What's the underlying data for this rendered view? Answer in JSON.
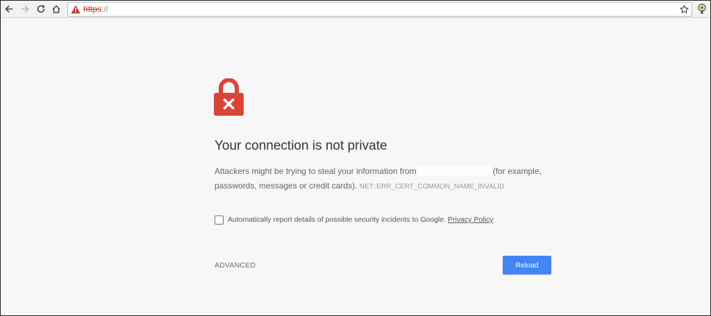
{
  "browser": {
    "url_scheme": "https",
    "url_rest": "://",
    "icons": {
      "back": "back-arrow-icon",
      "forward": "forward-arrow-icon",
      "reload": "reload-icon",
      "home": "home-icon",
      "warning": "warning-triangle-icon",
      "bookmark": "star-icon",
      "extension": "extension-icon"
    }
  },
  "interstitial": {
    "heading": "Your connection is not private",
    "body_part1": "Attackers might be trying to steal your information from",
    "body_part2": "(for example, passwords, messages or credit cards).",
    "error_code": "NET::ERR_CERT_COMMON_NAME_INVALID",
    "checkbox_label": "Automatically report details of possible security incidents to Google.",
    "privacy_link": "Privacy Policy",
    "advanced_label": "ADVANCED",
    "reload_label": "Reload",
    "icon": "lock-error-icon"
  },
  "colors": {
    "danger_red": "#db4437",
    "primary_blue": "#4285f4",
    "page_bg": "#f7f7f7"
  }
}
